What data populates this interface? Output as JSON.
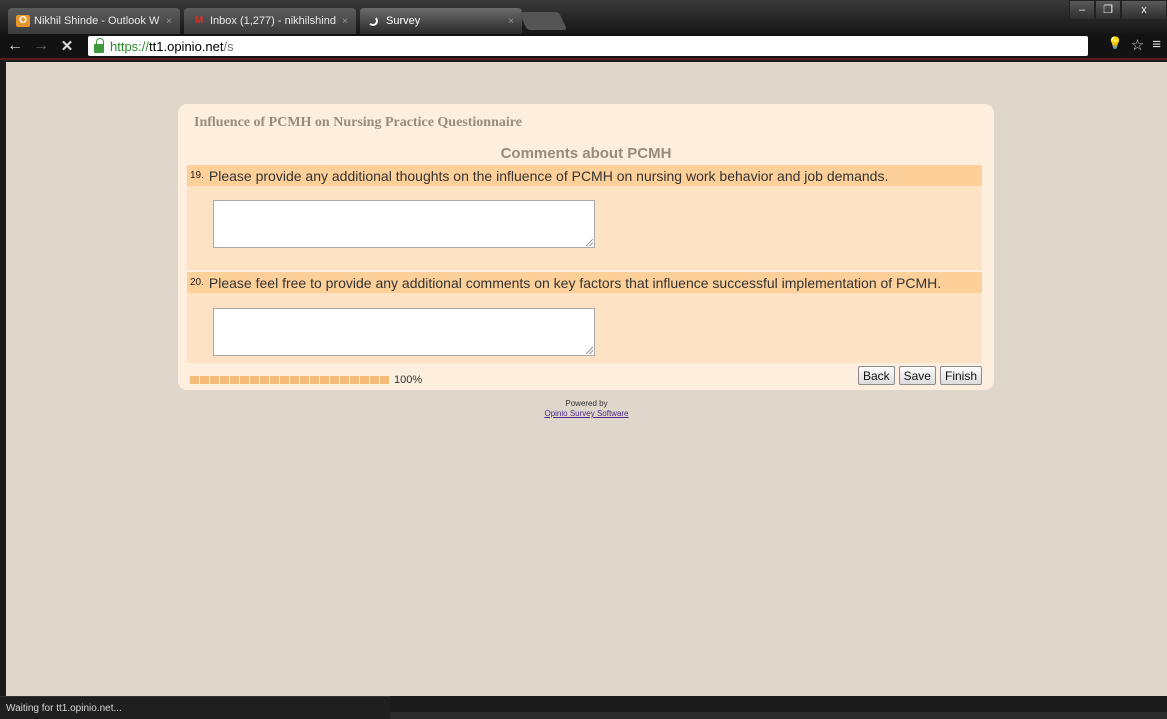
{
  "browser": {
    "tabs": [
      {
        "title": "Nikhil Shinde - Outlook W",
        "icon": "outlook-icon"
      },
      {
        "title": "Inbox (1,277) - nikhilshinde",
        "icon": "gmail-icon"
      },
      {
        "title": "Survey",
        "icon": "loading-spinner-icon"
      }
    ],
    "tab_close": "×",
    "window": {
      "minimize": "–",
      "maximize": "❐",
      "close": "x"
    },
    "nav": {
      "back": "←",
      "forward": "→",
      "stop": "✕"
    },
    "url": {
      "scheme": "https://",
      "host": "tt1.opinio.net",
      "path": "/s"
    },
    "toolbar_icons": {
      "bulb": "💡",
      "star": "☆",
      "menu": "≡"
    }
  },
  "survey": {
    "title": "Influence of PCMH on Nursing Practice Questionnaire",
    "section": "Comments about PCMH",
    "questions": [
      {
        "number": "19.",
        "text": "Please provide any additional thoughts on the influence of PCMH on nursing work behavior and job demands.",
        "value": ""
      },
      {
        "number": "20.",
        "text": "Please feel free to provide any additional comments on key factors that influence successful implementation of PCMH.",
        "value": ""
      }
    ],
    "progress": {
      "percent": 100,
      "label": "100%",
      "segments": 20
    },
    "buttons": {
      "back": "Back",
      "save": "Save",
      "finish": "Finish"
    }
  },
  "footer": {
    "powered_by": "Powered by",
    "link": "Opinio Survey Software"
  },
  "status": "Waiting for tt1.opinio.net...",
  "colors": {
    "page_bg": "#dfd6cc",
    "panel": "#fdeedd",
    "question_header": "#fdd09a",
    "question_body": "#fde3c3",
    "progress": "#f6ba79",
    "heading": "#9b8b7b"
  }
}
